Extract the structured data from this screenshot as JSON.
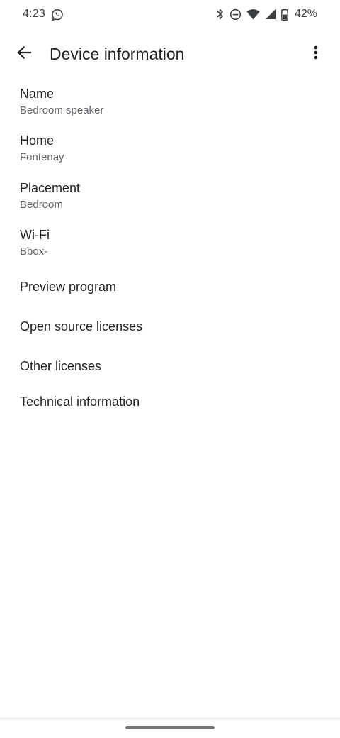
{
  "status_bar": {
    "time": "4:23",
    "battery_percent": "42%",
    "icons": [
      "whatsapp-icon",
      "bluetooth-icon",
      "do-not-disturb-icon",
      "wifi-icon",
      "cell-signal-icon",
      "battery-icon"
    ]
  },
  "app_bar": {
    "title": "Device information",
    "icons": [
      "arrow-back-icon",
      "more-vert-icon"
    ]
  },
  "settings": {
    "items": [
      {
        "title": "Name",
        "subtitle": "Bedroom speaker"
      },
      {
        "title": "Home",
        "subtitle": "Fontenay"
      },
      {
        "title": "Placement",
        "subtitle": "Bedroom"
      },
      {
        "title": "Wi-Fi",
        "subtitle": "Bbox-"
      },
      {
        "title": "Preview program"
      },
      {
        "title": "Open source licenses"
      },
      {
        "title": "Other licenses"
      },
      {
        "title": "Technical information"
      }
    ]
  },
  "colors": {
    "primary_text": "#202124",
    "secondary_text": "#5f6368",
    "background": "#ffffff"
  }
}
